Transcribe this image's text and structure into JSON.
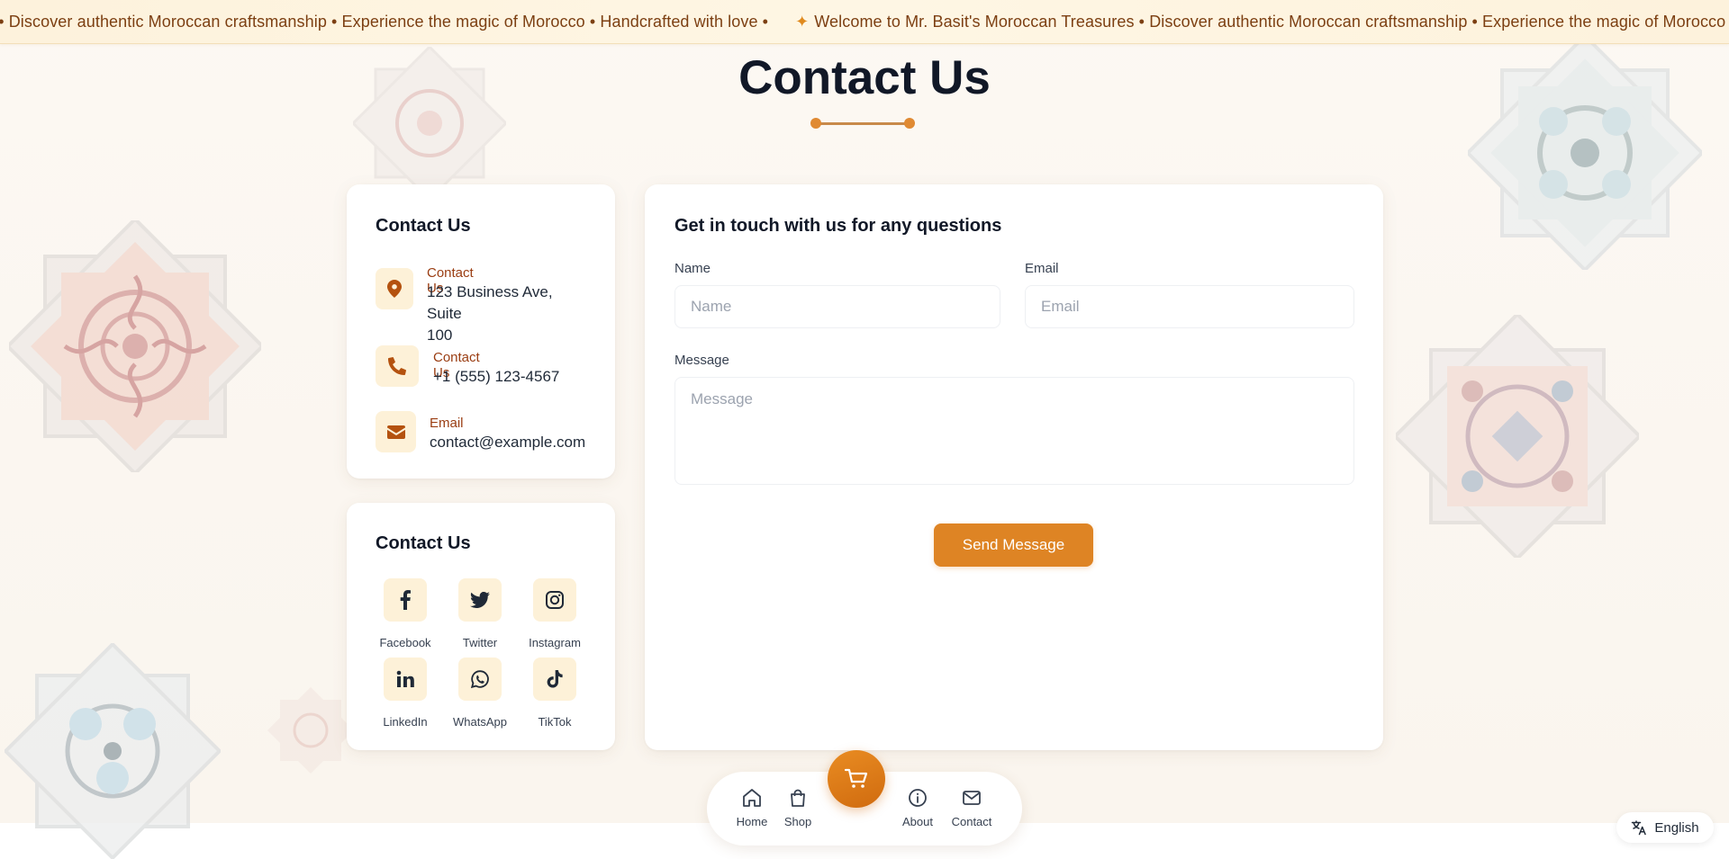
{
  "marquee": {
    "segment_a": "s • Discover authentic Moroccan craftsmanship • Experience the magic of Morocco • Handcrafted with love •",
    "star": "✦",
    "segment_b": "Welcome to Mr. Basit's Moroccan Treasures • Discover authentic Moroccan craftsmanship • Experience the magic of Morocco"
  },
  "page": {
    "title": "Contact Us"
  },
  "contact_info": {
    "title": "Contact Us",
    "address": {
      "label": "Contact Us",
      "line1": "123 Business Ave,",
      "line2": "Suite 100"
    },
    "phone": {
      "label": "Contact Us",
      "value": "+1 (555) 123-4567"
    },
    "email": {
      "label": "Email",
      "value": "contact@example.com"
    }
  },
  "social": {
    "title": "Contact Us",
    "items": [
      {
        "label": "Facebook",
        "icon": "facebook-icon"
      },
      {
        "label": "Twitter",
        "icon": "twitter-icon"
      },
      {
        "label": "Instagram",
        "icon": "instagram-icon"
      },
      {
        "label": "LinkedIn",
        "icon": "linkedin-icon"
      },
      {
        "label": "WhatsApp",
        "icon": "whatsapp-icon"
      },
      {
        "label": "TikTok",
        "icon": "tiktok-icon"
      }
    ]
  },
  "form": {
    "title": "Get in touch with us for any questions",
    "name_label": "Name",
    "name_placeholder": "Name",
    "name_value": "",
    "email_label": "Email",
    "email_placeholder": "Email",
    "email_value": "",
    "message_label": "Message",
    "message_placeholder": "Message",
    "message_value": "",
    "submit_label": "Send Message"
  },
  "bottom_nav": {
    "home": "Home",
    "shop": "Shop",
    "cart_icon": "cart-icon",
    "about": "About",
    "contact": "Contact"
  },
  "language": {
    "label": "English",
    "icon": "translate-icon"
  },
  "colors": {
    "accent": "#de8424",
    "accent_dark": "#9a3d12",
    "icon_bg": "#fdf1d8",
    "marquee_text": "#7c3f12"
  }
}
